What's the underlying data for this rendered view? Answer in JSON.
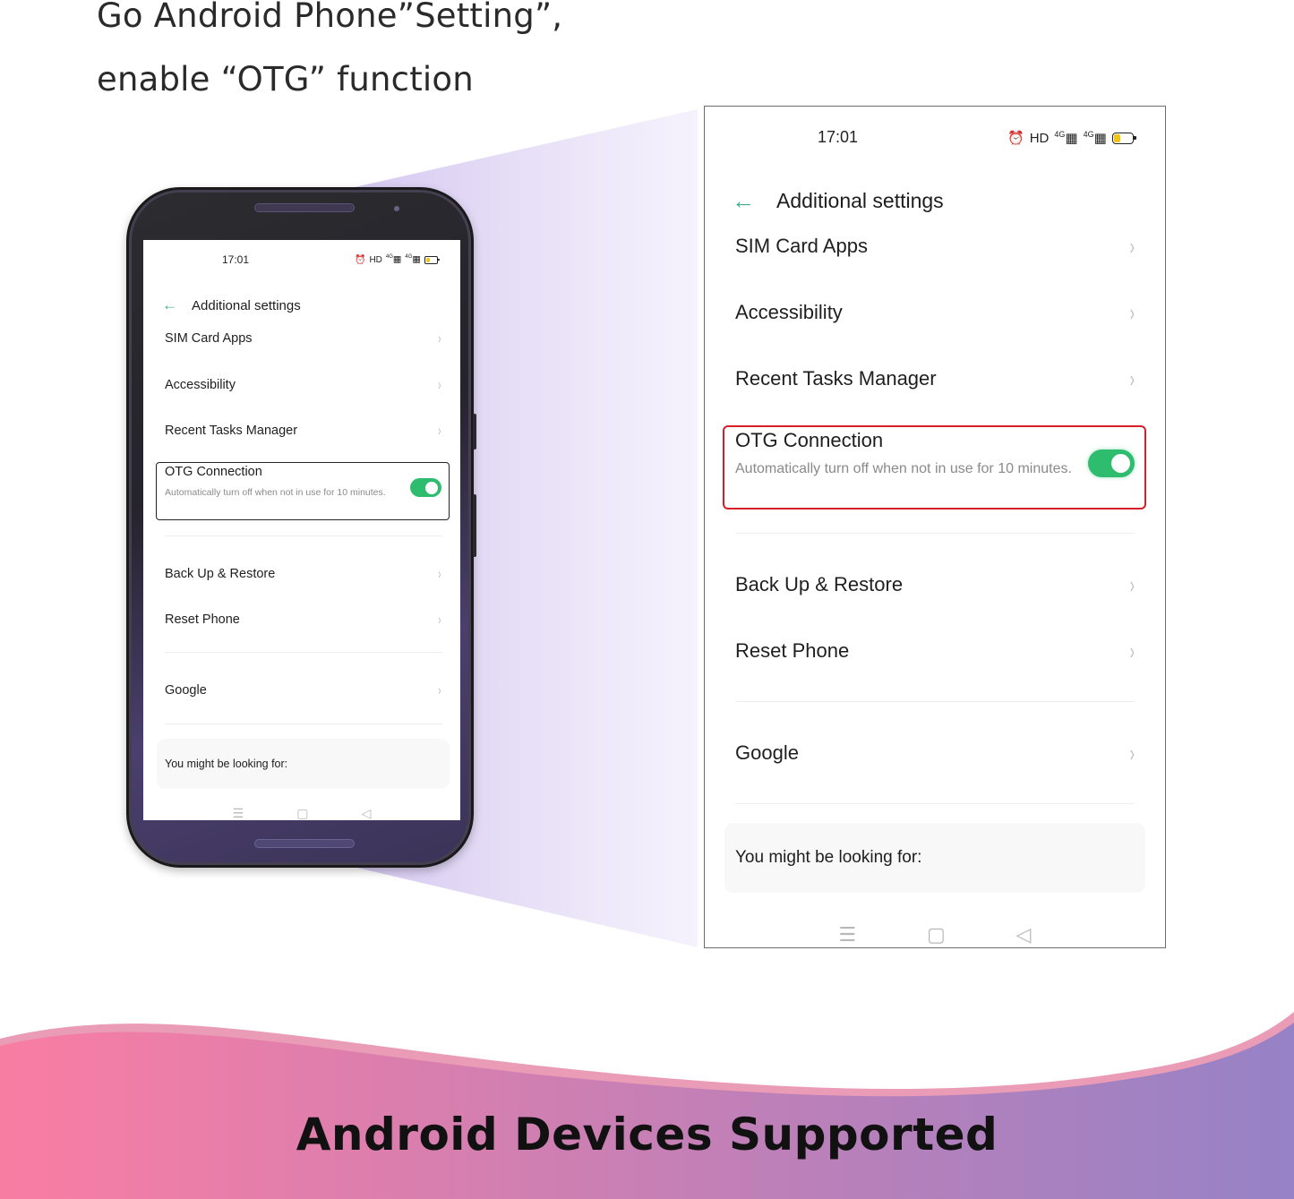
{
  "headline": {
    "line1": "Go Android Phone”Setting”,",
    "line2": "enable “OTG” function"
  },
  "screen": {
    "status_bar": {
      "time": "17:01",
      "icons": [
        "alarm-icon",
        "hd-icon",
        "signal-4g-icon",
        "signal-4g-icon",
        "battery-icon"
      ],
      "hd_label": "HD",
      "sig1_label": "4G",
      "sig2_label": "4G",
      "battery_level": 0.35,
      "battery_color": "#f1c40f"
    },
    "title": "Additional settings",
    "back_icon": "←",
    "items": [
      {
        "label": "SIM Card Apps",
        "chevron": "›"
      },
      {
        "label": "Accessibility",
        "chevron": "›"
      },
      {
        "label": "Recent Tasks Manager",
        "chevron": "›"
      }
    ],
    "otg": {
      "title": "OTG Connection",
      "subtitle": "Automatically turn off when not in use for 10 minutes.",
      "enabled": true,
      "toggle_color": "#2ebd6e",
      "highlight_color": "#d61e2a"
    },
    "items2": [
      {
        "label": "Back Up & Restore",
        "chevron": "›"
      },
      {
        "label": "Reset Phone",
        "chevron": "›"
      }
    ],
    "items3": [
      {
        "label": "Google",
        "chevron": "›"
      }
    ],
    "looking_for": "You might be looking for:",
    "navbar": {
      "menu": "☰",
      "home": "▢",
      "back": "◁"
    }
  },
  "footer": {
    "text": "Android Devices Supported",
    "gradient_start": "#f97da3",
    "gradient_end": "#9682c6"
  }
}
